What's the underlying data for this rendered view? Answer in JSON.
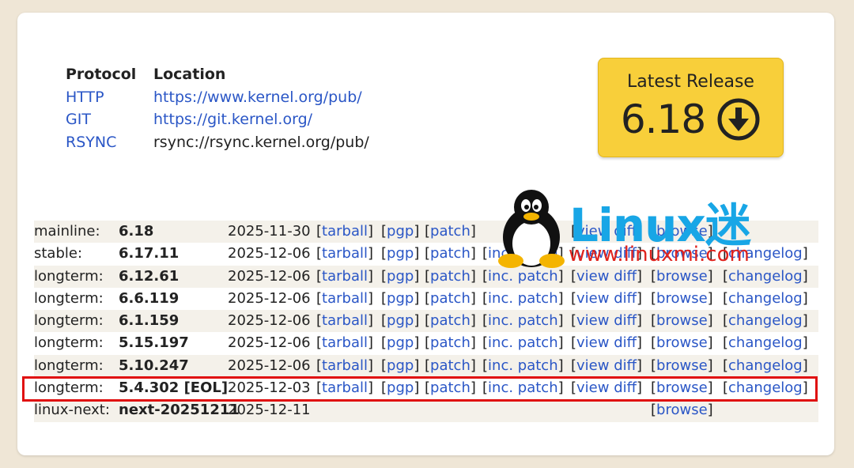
{
  "protocols": {
    "header": {
      "protocol": "Protocol",
      "location": "Location"
    },
    "rows": [
      {
        "protocol": "HTTP",
        "location": "https://www.kernel.org/pub/",
        "location_is_link": true
      },
      {
        "protocol": "GIT",
        "location": "https://git.kernel.org/",
        "location_is_link": true
      },
      {
        "protocol": "RSYNC",
        "location": "rsync://rsync.kernel.org/pub/",
        "location_is_link": false
      }
    ]
  },
  "latest_release": {
    "label": "Latest Release",
    "version": "6.18",
    "icon": "download-circle-icon"
  },
  "releases": [
    {
      "kind": "mainline:",
      "version": "6.18",
      "date": "2025-11-30",
      "tarball": "tarball",
      "pgp": "pgp",
      "patch": "patch",
      "inc_patch": "",
      "view_diff": "view diff",
      "browse": "browse",
      "changelog": ""
    },
    {
      "kind": "stable:",
      "version": "6.17.11",
      "date": "2025-12-06",
      "tarball": "tarball",
      "pgp": "pgp",
      "patch": "patch",
      "inc_patch": "inc. patch",
      "view_diff": "view diff",
      "browse": "browse",
      "changelog": "changelog"
    },
    {
      "kind": "longterm:",
      "version": "6.12.61",
      "date": "2025-12-06",
      "tarball": "tarball",
      "pgp": "pgp",
      "patch": "patch",
      "inc_patch": "inc. patch",
      "view_diff": "view diff",
      "browse": "browse",
      "changelog": "changelog"
    },
    {
      "kind": "longterm:",
      "version": "6.6.119",
      "date": "2025-12-06",
      "tarball": "tarball",
      "pgp": "pgp",
      "patch": "patch",
      "inc_patch": "inc. patch",
      "view_diff": "view diff",
      "browse": "browse",
      "changelog": "changelog"
    },
    {
      "kind": "longterm:",
      "version": "6.1.159",
      "date": "2025-12-06",
      "tarball": "tarball",
      "pgp": "pgp",
      "patch": "patch",
      "inc_patch": "inc. patch",
      "view_diff": "view diff",
      "browse": "browse",
      "changelog": "changelog"
    },
    {
      "kind": "longterm:",
      "version": "5.15.197",
      "date": "2025-12-06",
      "tarball": "tarball",
      "pgp": "pgp",
      "patch": "patch",
      "inc_patch": "inc. patch",
      "view_diff": "view diff",
      "browse": "browse",
      "changelog": "changelog"
    },
    {
      "kind": "longterm:",
      "version": "5.10.247",
      "date": "2025-12-06",
      "tarball": "tarball",
      "pgp": "pgp",
      "patch": "patch",
      "inc_patch": "inc. patch",
      "view_diff": "view diff",
      "browse": "browse",
      "changelog": "changelog"
    },
    {
      "kind": "longterm:",
      "version": "5.4.302 [EOL]",
      "date": "2025-12-03",
      "tarball": "tarball",
      "pgp": "pgp",
      "patch": "patch",
      "inc_patch": "inc. patch",
      "view_diff": "view diff",
      "browse": "browse",
      "changelog": "changelog"
    },
    {
      "kind": "linux-next:",
      "version": "next-20251211",
      "date": "2025-12-11",
      "tarball": "",
      "pgp": "",
      "patch": "",
      "inc_patch": "",
      "view_diff": "",
      "browse": "browse",
      "changelog": ""
    }
  ],
  "watermark": {
    "brand": "Linux迷",
    "url": "www.linuxmi.com"
  },
  "colors": {
    "link": "#2a56c6",
    "release_box": "#f8cf3a",
    "highlight": "#e01010",
    "watermark_blue": "#18a6e6",
    "watermark_red": "#e0231d"
  }
}
